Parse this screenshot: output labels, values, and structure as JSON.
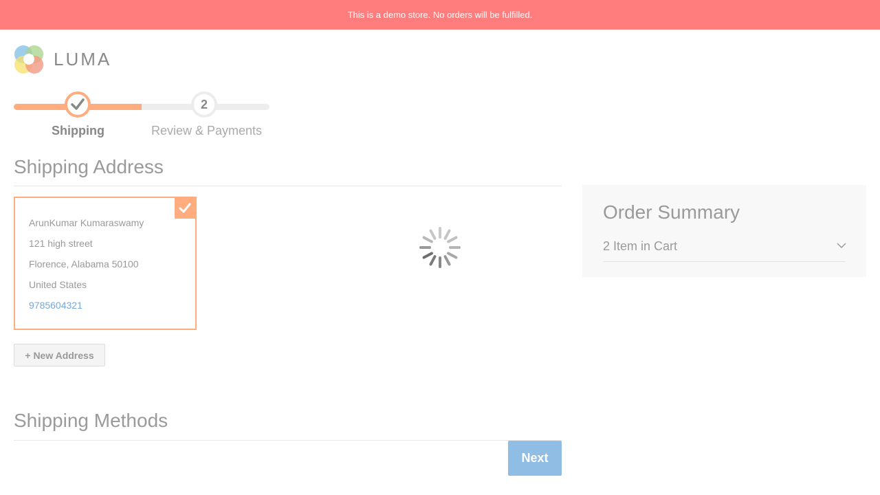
{
  "banner": {
    "text": "This is a demo store. No orders will be fulfilled."
  },
  "logo": {
    "text": "LUMA"
  },
  "progress": {
    "steps": [
      {
        "label": "Shipping",
        "state": "complete"
      },
      {
        "label": "Review & Payments",
        "number": "2",
        "state": "pending"
      }
    ]
  },
  "shipping_address": {
    "title": "Shipping Address",
    "selected_address": {
      "name": "ArunKumar Kumaraswamy",
      "street": "121 high street",
      "city_line": "Florence, Alabama 50100",
      "country": "United States",
      "phone": "9785604321"
    },
    "new_address_label": "+ New Address"
  },
  "shipping_methods": {
    "title": "Shipping Methods"
  },
  "order_summary": {
    "title": "Order Summary",
    "items_in_cart": "2 Item in Cart"
  },
  "buttons": {
    "next_label": "Next"
  },
  "colors": {
    "banner": "#ff7d7d",
    "accent": "#ffad7f",
    "next_button": "#8fbde4",
    "link": "#75a8d8"
  }
}
